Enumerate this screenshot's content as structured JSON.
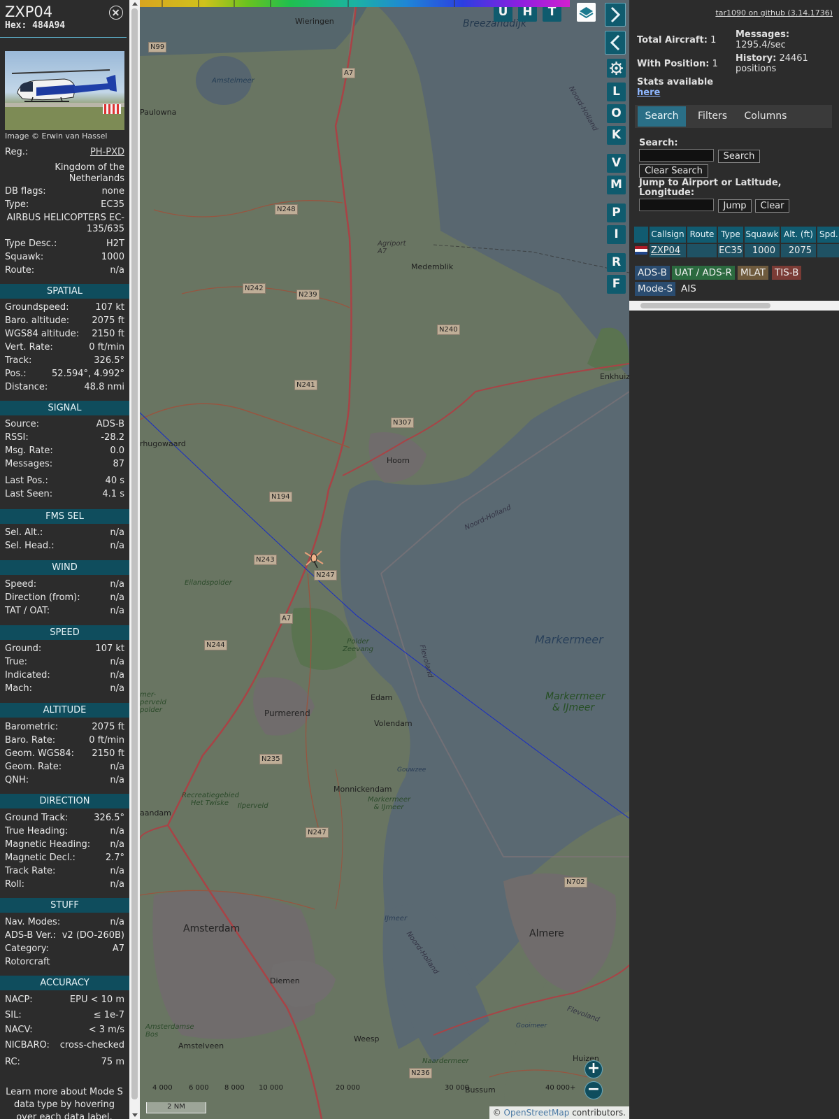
{
  "info": {
    "callsign": "ZXP04",
    "hex": "Hex: 484A94",
    "photo_credit": "Image © Erwin van Hassel",
    "reg_label": "Reg.:",
    "reg_value": "PH-PXD",
    "country": "Kingdom of the Netherlands",
    "dbflags_label": "DB flags:",
    "dbflags_value": "none",
    "type_label": "Type:",
    "type_value": "EC35",
    "type_full": "AIRBUS HELICOPTERS EC-135/635",
    "typedesc_label": "Type Desc.:",
    "typedesc_value": "H2T",
    "squawk_label": "Squawk:",
    "squawk_value": "1000",
    "route_label": "Route:",
    "route_value": "n/a"
  },
  "sections": {
    "spatial": {
      "title": "SPATIAL",
      "rows": [
        {
          "label": "Groundspeed:",
          "value": "107 kt"
        },
        {
          "label": "Baro. altitude:",
          "value": "2075 ft"
        },
        {
          "label": "WGS84 altitude:",
          "value": "2150 ft"
        },
        {
          "label": "Vert. Rate:",
          "value": "0 ft/min"
        },
        {
          "label": "Track:",
          "value": "326.5°"
        },
        {
          "label": "Pos.:",
          "value": "52.594°, 4.992°"
        },
        {
          "label": "Distance:",
          "value": "48.8 nmi"
        }
      ]
    },
    "signal": {
      "title": "SIGNAL",
      "rows": [
        {
          "label": "Source:",
          "value": "ADS-B"
        },
        {
          "label": "RSSI:",
          "value": "-28.2"
        },
        {
          "label": "Msg. Rate:",
          "value": "0.0"
        },
        {
          "label": "Messages:",
          "value": "87"
        },
        {
          "label": "Last Pos.:",
          "value": "40 s"
        },
        {
          "label": "Last Seen:",
          "value": "4.1 s"
        }
      ]
    },
    "fms": {
      "title": "FMS SEL",
      "rows": [
        {
          "label": "Sel. Alt.:",
          "value": "n/a"
        },
        {
          "label": "Sel. Head.:",
          "value": "n/a"
        }
      ]
    },
    "wind": {
      "title": "WIND",
      "rows": [
        {
          "label": "Speed:",
          "value": "n/a"
        },
        {
          "label": "Direction (from):",
          "value": "n/a"
        },
        {
          "label": "TAT / OAT:",
          "value": "n/a"
        }
      ]
    },
    "speed": {
      "title": "SPEED",
      "rows": [
        {
          "label": "Ground:",
          "value": "107 kt"
        },
        {
          "label": "True:",
          "value": "n/a"
        },
        {
          "label": "Indicated:",
          "value": "n/a"
        },
        {
          "label": "Mach:",
          "value": "n/a"
        }
      ]
    },
    "altitude": {
      "title": "ALTITUDE",
      "rows": [
        {
          "label": "Barometric:",
          "value": "2075 ft"
        },
        {
          "label": "Baro. Rate:",
          "value": "0 ft/min"
        },
        {
          "label": "Geom. WGS84:",
          "value": "2150 ft"
        },
        {
          "label": "Geom. Rate:",
          "value": "n/a"
        },
        {
          "label": "QNH:",
          "value": "n/a"
        }
      ]
    },
    "direction": {
      "title": "DIRECTION",
      "rows": [
        {
          "label": "Ground Track:",
          "value": "326.5°"
        },
        {
          "label": "True Heading:",
          "value": "n/a"
        },
        {
          "label": "Magnetic Heading:",
          "value": "n/a"
        },
        {
          "label": "Magnetic Decl.:",
          "value": "2.7°"
        },
        {
          "label": "Track Rate:",
          "value": "n/a"
        },
        {
          "label": "Roll:",
          "value": "n/a"
        }
      ]
    },
    "stuff": {
      "title": "STUFF",
      "rows": [
        {
          "label": "Nav. Modes:",
          "value": "n/a"
        },
        {
          "label": "ADS-B Ver.:",
          "value": "v2 (DO-260B)"
        },
        {
          "label": "Category:",
          "value": "A7"
        },
        {
          "label": "Rotorcraft",
          "value": ""
        }
      ]
    },
    "accuracy": {
      "title": "ACCURACY",
      "rows": [
        {
          "label": "NACP:",
          "value": "EPU < 10 m"
        },
        {
          "label": "SIL:",
          "value": "≤ 1e-7"
        },
        {
          "label": "NACV:",
          "value": "< 3 m/s"
        },
        {
          "label": "NICBARO:",
          "value": "cross-checked"
        },
        {
          "label": "RC:",
          "value": "75 m"
        }
      ]
    }
  },
  "learn_more": "Learn more about Mode S data type by hovering over each data label.",
  "map": {
    "buttons_top": [
      "U",
      "H",
      "T"
    ],
    "buttons_side": [
      "L",
      "O",
      "K",
      "V",
      "M",
      "P",
      "I",
      "R",
      "F"
    ],
    "places": {
      "wieringen": "Wieringen",
      "breezanddijk": "Breezanddijk",
      "amstelmeer": "Amstelmeer",
      "paulowna": "Paulowna",
      "agriport": "Agriport A7",
      "medemblik": "Medemblik",
      "enkhuizen": "Enkhuiz",
      "hugowaard": "rhugowaard",
      "hoorn": "Hoorn",
      "noordholland1": "Noord-Holland",
      "noordholland2": "Noord-Holland",
      "noordholland3": "Noord-Holland",
      "eilandspolder": "Eilandspolder",
      "polder_zeevang": "Polder Zeevang",
      "flevoland1": "Flevoland",
      "flevoland2": "Flevoland",
      "markermeer": "Markermeer",
      "markermeer_ijmeer": "Markermeer & IJmeer",
      "markermeer_ijmeer2": "Markermeer & IJmeer",
      "edam": "Edam",
      "volendam": "Volendam",
      "purmerend": "Purmerend",
      "monnickendam": "Monnickendam",
      "gouwzee": "Gouwzee",
      "recreatiegebied": "Recreatiegebied Het Twiske",
      "ilperveld": "Ilperveld",
      "amsterdam": "Amsterdam",
      "almere": "Almere",
      "ijmeer": "IJmeer",
      "diemen": "Diemen",
      "weesp": "Weesp",
      "amstelveen": "Amstelveen",
      "bussum": "Bussum",
      "huizen": "Huizen",
      "naardermeer": "Naardermeer",
      "gooimeer": "Gooimeer",
      "amsterdamse_bos": "Amsterdamse Bos",
      "aandam": "aandam",
      "perveld": "mer- perveld polder"
    },
    "roads": [
      "N99",
      "A7",
      "N248",
      "N242",
      "N239",
      "N240",
      "N241",
      "N307",
      "N194",
      "N243",
      "N247",
      "A7",
      "N244",
      "N235",
      "N247",
      "N702",
      "N236"
    ],
    "alt_ticks": [
      "4 000",
      "6 000",
      "8 000",
      "10 000",
      "20 000",
      "30 000",
      "40 000+"
    ],
    "scale": "2 NM",
    "zoom_in": "+",
    "zoom_out": "−",
    "attribution_prefix": "© ",
    "attribution_link": "OpenStreetMap",
    "attribution_suffix": " contributors."
  },
  "sidebar": {
    "github": "tar1090 on github (3.14.1736)",
    "total_label": "Total Aircraft:",
    "total_value": "1",
    "messages_label": "Messages:",
    "messages_value": "1295.4/sec",
    "withpos_label": "With Position:",
    "withpos_value": "1",
    "history_label": "History:",
    "history_value": "24461 positions",
    "stats_text": "Stats available",
    "stats_link": "here",
    "tabs": [
      "Search",
      "Filters",
      "Columns"
    ],
    "search_label": "Search:",
    "search_button": "Search",
    "clear_search_button": "Clear Search",
    "jump_label": "Jump to Airport or Latitude, Longitude:",
    "jump_button": "Jump",
    "clear_button": "Clear",
    "table_headers": [
      "Callsign",
      "Route",
      "Type",
      "Squawk",
      "Alt. (ft)",
      "Spd."
    ],
    "table_row": {
      "callsign": "ZXP04",
      "route": "",
      "type": "EC35",
      "squawk": "1000",
      "alt": "2075"
    },
    "legend": [
      "ADS-B",
      "UAT / ADS-R",
      "MLAT",
      "TIS-B",
      "Mode-S",
      "AIS"
    ]
  },
  "colors": {
    "section_head": "#0f4d5d",
    "button_teal": "#0f5b6e",
    "tab_active": "#2a6f87",
    "adsb": "#2a4c70",
    "uat": "#2b6a3f",
    "mlat": "#6e5a3d",
    "tisb": "#7a3b35",
    "modes": "#2a4c70"
  }
}
